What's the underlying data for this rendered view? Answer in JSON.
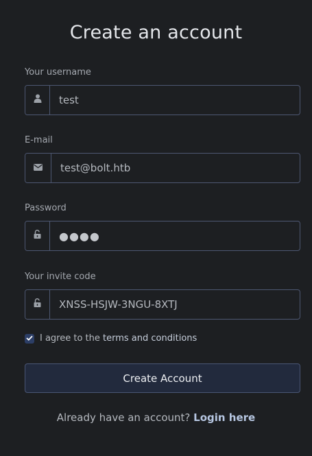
{
  "form": {
    "title": "Create an account",
    "username": {
      "label": "Your username",
      "value": "test",
      "icon": "user-icon"
    },
    "email": {
      "label": "E-mail",
      "value": "test@bolt.htb",
      "icon": "envelope-icon"
    },
    "password": {
      "label": "Password",
      "value": "●●●●",
      "icon": "unlock-icon"
    },
    "invite": {
      "label": "Your invite code",
      "value": "XNSS-HSJW-3NGU-8XTJ",
      "icon": "unlock-icon"
    },
    "agree": {
      "checked": true,
      "prefix": "I agree to the ",
      "link": "terms and conditions"
    },
    "submit_label": "Create Account",
    "login_prompt": "Already have an account? ",
    "login_link": "Login here"
  },
  "colors": {
    "background": "#1d1f22",
    "border": "#4e5873",
    "button": "#222a3d",
    "link": "#b7c7e2"
  }
}
